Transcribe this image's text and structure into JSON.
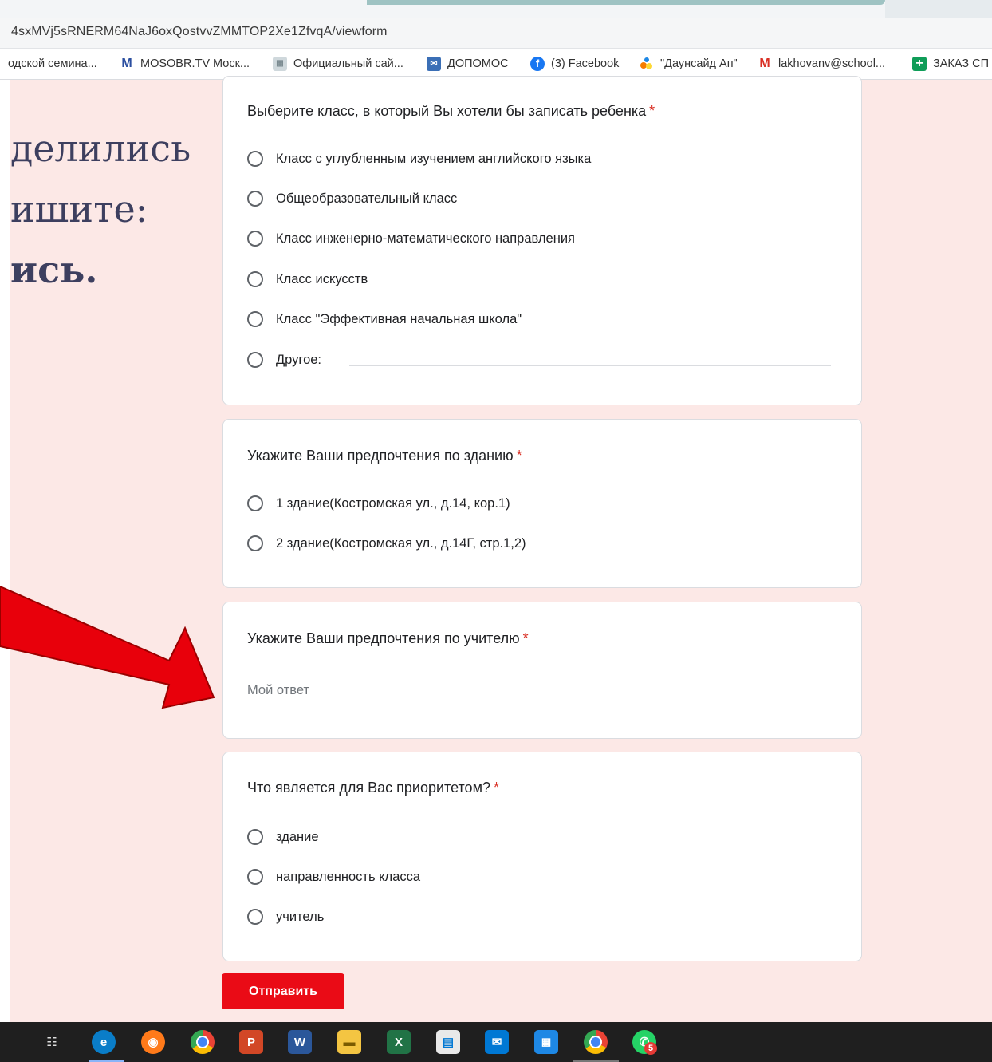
{
  "browser": {
    "url": "4sxMVj5sRNERM64NaJ6oxQostvvZMMTOP2Xe1ZfvqA/viewform",
    "bookmarks": [
      {
        "label": "одской семина...",
        "icon": "page-icon"
      },
      {
        "label": "MOSOBR.TV Моск...",
        "icon": "mosobr-logo-icon",
        "color": "#2b4fa0"
      },
      {
        "label": "Официальный сай...",
        "icon": "site-icon"
      },
      {
        "label": "ДОПОМОС",
        "icon": "dopomos-icon"
      },
      {
        "label": "(3) Facebook",
        "icon": "facebook-icon",
        "color": "#1877f2"
      },
      {
        "label": "\"Даунсайд Ап\"",
        "icon": "downside-up-icon"
      },
      {
        "label": "lakhovanv@school...",
        "icon": "gmail-icon",
        "color": "#d93025"
      },
      {
        "label": "ЗАКАЗ СП",
        "icon": "sheets-plus-icon",
        "color": "#0f9d58"
      }
    ]
  },
  "slide": {
    "lines": [
      "делились",
      "ишите:",
      "ись."
    ]
  },
  "form": {
    "accent": "#d93025",
    "required_mark": "*",
    "questions": [
      {
        "title": "Выберите класс, в который Вы хотели бы записать ребенка",
        "options": [
          "Класс с углубленным изучением английского языка",
          "Общеобразовательный класс",
          "Класс инженерно-математического направления",
          "Класс искусств",
          "Класс \"Эффективная начальная школа\"",
          "Другое:"
        ]
      },
      {
        "title": "Укажите Ваши предпочтения по зданию",
        "options": [
          "1 здание(Костромская ул., д.14, кор.1)",
          "2 здание(Костромская ул., д.14Г, стр.1,2)"
        ]
      },
      {
        "title": "Укажите Ваши предпочтения по учителю",
        "placeholder": "Мой ответ"
      },
      {
        "title": "Что является для Вас приоритетом?",
        "options": [
          "здание",
          "направленность класса",
          "учитель"
        ]
      }
    ],
    "submit_label": "Отправить",
    "submit_color": "#ea0b16"
  },
  "taskbar": {
    "icons": [
      "task-view-icon",
      "edge-icon",
      "firefox-icon",
      "chrome-icon",
      "powerpoint-icon",
      "word-icon",
      "file-explorer-icon",
      "excel-icon",
      "store-icon",
      "mail-icon",
      "calendar-icon",
      "chrome-profile-icon",
      "whatsapp-icon"
    ],
    "whatsapp_badge": "5"
  }
}
